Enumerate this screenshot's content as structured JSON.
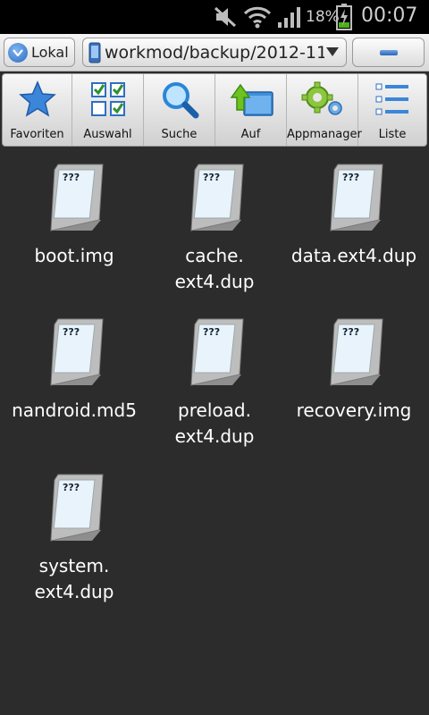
{
  "statusbar": {
    "battery_percent": "18%",
    "time": "00:07",
    "icons": [
      "mute-icon",
      "wifi-icon",
      "signal-icon",
      "battery-charging-icon"
    ]
  },
  "pathbar": {
    "location_label": "Lokal",
    "path": "workmod/backup/2012-11-",
    "minimize_icon": "minus-icon"
  },
  "toolbar": {
    "items": [
      {
        "label": "Favoriten",
        "icon": "star-icon"
      },
      {
        "label": "Auswahl",
        "icon": "checklist-icon"
      },
      {
        "label": "Suche",
        "icon": "magnifier-icon"
      },
      {
        "label": "Auf",
        "icon": "folder-up-icon"
      },
      {
        "label": "Appmanager",
        "icon": "gears-icon"
      },
      {
        "label": "Liste",
        "icon": "list-view-icon"
      }
    ]
  },
  "files": [
    {
      "name": "boot.img",
      "icon_text": "???"
    },
    {
      "name": "cache.\next4.dup",
      "icon_text": "???"
    },
    {
      "name": "data.ext4.dup",
      "icon_text": "???"
    },
    {
      "name": "nandroid.md5",
      "icon_text": "???"
    },
    {
      "name": "preload.\next4.dup",
      "icon_text": "???"
    },
    {
      "name": "recovery.img",
      "icon_text": "???"
    },
    {
      "name": "system.\next4.dup",
      "icon_text": "???"
    }
  ],
  "colors": {
    "background": "#2c2c2c",
    "accent_blue": "#2b6cc2",
    "file_text": "#ffffff"
  }
}
